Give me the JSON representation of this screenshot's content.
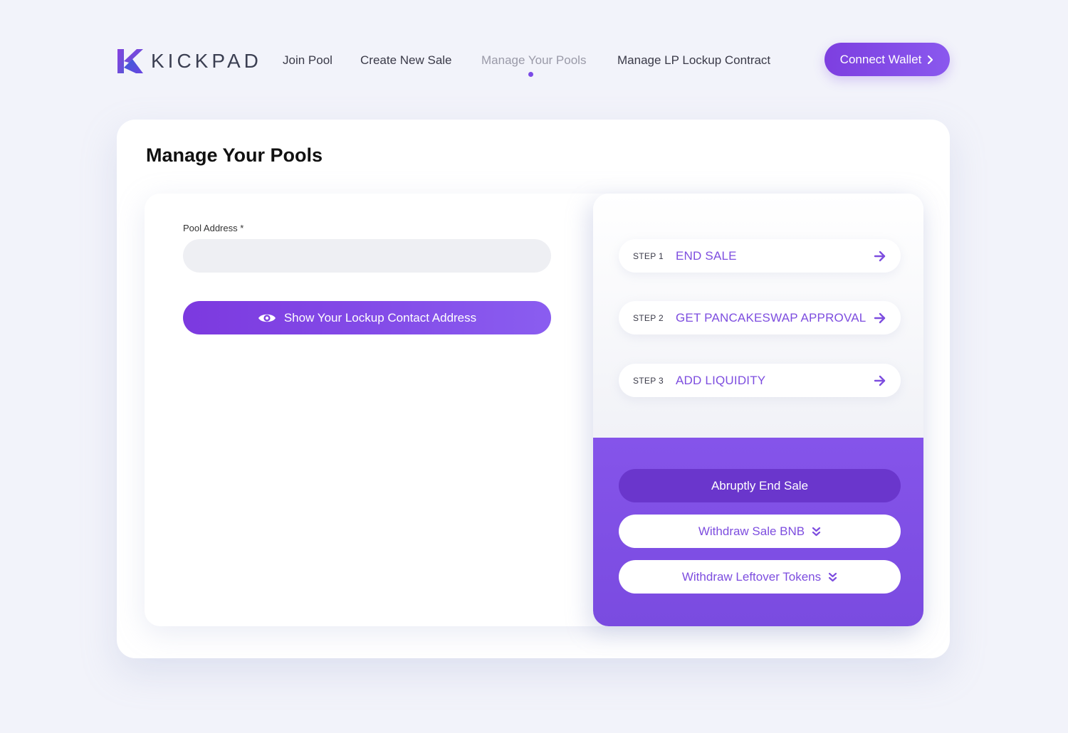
{
  "brand": {
    "name": "KICKPAD",
    "color_primary": "#7d3fe0",
    "color_accent": "#6a36cc"
  },
  "nav": {
    "items": [
      {
        "label": "Join Pool"
      },
      {
        "label": "Create New Sale"
      },
      {
        "label": "Manage Your Pools",
        "active": true
      },
      {
        "label": "Manage LP Lockup Contract"
      }
    ],
    "connect_label": "Connect Wallet",
    "connect_icon": "chevron-right-icon"
  },
  "main": {
    "title": "Manage Your Pools",
    "pool_address": {
      "label": "Pool Address *",
      "value": "",
      "placeholder": ""
    },
    "show_button": {
      "label": "Show Your Lockup Contact Address",
      "icon": "eye-icon"
    }
  },
  "steps": [
    {
      "num": "STEP 1",
      "label": "END SALE",
      "icon": "arrow-right-icon"
    },
    {
      "num": "STEP 2",
      "label": "GET PANCAKESWAP APPROVAL",
      "icon": "arrow-right-icon"
    },
    {
      "num": "STEP 3",
      "label": "ADD LIQUIDITY",
      "icon": "arrow-right-icon"
    }
  ],
  "actions": {
    "abrupt_label": "Abruptly End Sale",
    "withdraw_bnb_label": "Withdraw Sale BNB",
    "withdraw_tokens_label": "Withdraw Leftover Tokens",
    "withdraw_icon": "double-chevron-down-icon"
  }
}
